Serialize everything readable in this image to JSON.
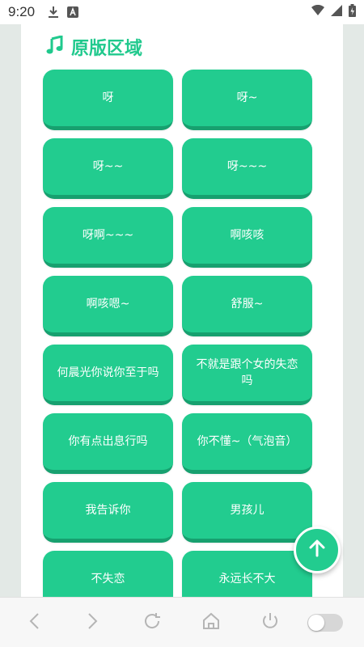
{
  "status_bar": {
    "time": "9:20"
  },
  "section": {
    "title": "原版区域",
    "icon": "music-note-icon"
  },
  "sound_buttons": [
    {
      "label": "呀"
    },
    {
      "label": "呀~"
    },
    {
      "label": "呀~~"
    },
    {
      "label": "呀~~~"
    },
    {
      "label": "呀啊~~~"
    },
    {
      "label": "啊咳咳"
    },
    {
      "label": "啊咳嗯~"
    },
    {
      "label": "舒服~"
    },
    {
      "label": "何晨光你说你至于吗"
    },
    {
      "label": "不就是跟个女的失恋吗"
    },
    {
      "label": "你有点出息行吗"
    },
    {
      "label": "你不懂~（气泡音）"
    },
    {
      "label": "我告诉你"
    },
    {
      "label": "男孩儿"
    },
    {
      "label": "不失恋"
    },
    {
      "label": "永远长不大"
    }
  ],
  "colors": {
    "accent": "#22cc8f",
    "accent_dark": "#17a06f",
    "title": "#20c98d"
  },
  "nav_bar": {
    "items": [
      "back-icon",
      "forward-icon",
      "refresh-icon",
      "home-icon",
      "power-icon",
      "toggle-switch"
    ]
  }
}
